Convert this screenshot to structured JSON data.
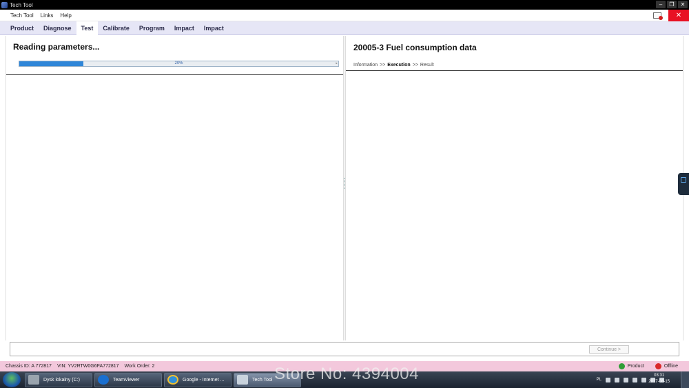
{
  "window": {
    "title": "Tech Tool"
  },
  "menu": {
    "items": [
      "Tech Tool",
      "Links",
      "Help"
    ]
  },
  "tabs": [
    {
      "label": "Product",
      "active": false
    },
    {
      "label": "Diagnose",
      "active": false
    },
    {
      "label": "Test",
      "active": true
    },
    {
      "label": "Calibrate",
      "active": false
    },
    {
      "label": "Program",
      "active": false
    },
    {
      "label": "Impact",
      "active": false
    },
    {
      "label": "Impact",
      "active": false
    }
  ],
  "left": {
    "title": "Reading parameters...",
    "progress_percent": 20,
    "progress_text": "20%"
  },
  "right": {
    "title": "20005-3 Fuel consumption data",
    "breadcrumb": {
      "step1": "Information",
      "sep1": ">>",
      "step2": "Execution",
      "sep2": ">>",
      "step3": "Result"
    }
  },
  "buttons": {
    "continue": "Continue >"
  },
  "status": {
    "chassis": "Chassis ID: A 772817",
    "vin": "VIN: YV2RTW0G6FA772817",
    "work_order": "Work Order: 2",
    "product": "Product",
    "offline": "Offline",
    "colors": {
      "product": "#2f9d36",
      "offline": "#d92a2a"
    }
  },
  "taskbar": {
    "items": [
      {
        "label": "Dysk lokalny (C:)",
        "icon": "drive-icon"
      },
      {
        "label": "TeamViewer",
        "icon": "teamviewer-icon"
      },
      {
        "label": "Google - Internet ...",
        "icon": "internet-explorer-icon"
      },
      {
        "label": "Tech Tool",
        "icon": "tech-tool-icon"
      }
    ],
    "language": "PL",
    "time": "03:31",
    "date": "2017-08-15"
  },
  "watermark": "Store No: 4394004"
}
